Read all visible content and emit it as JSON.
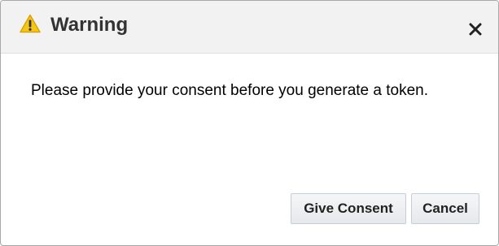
{
  "dialog": {
    "title": "Warning",
    "icon": "warning-icon",
    "close_icon": "close-icon",
    "message": "Please provide your consent before you generate a token.",
    "buttons": {
      "give_consent": "Give Consent",
      "cancel": "Cancel"
    }
  },
  "colors": {
    "warning_fill": "#f5c518",
    "header_bg": "#f2f2f3",
    "button_border": "#c4ced7"
  }
}
